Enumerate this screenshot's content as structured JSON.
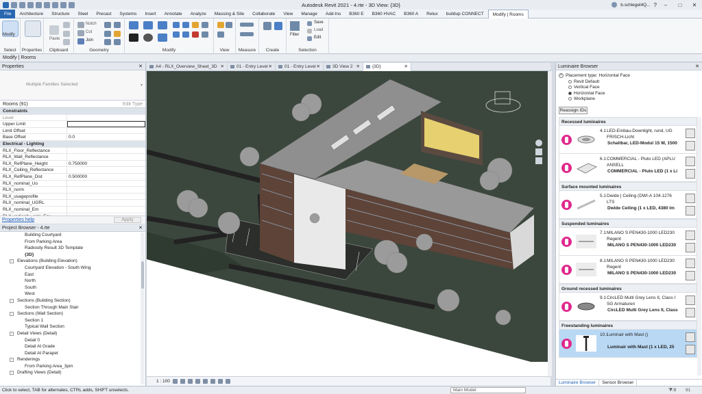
{
  "window": {
    "title": "Autodesk Revit 2021 - 4.rte - 3D View: {3D}",
    "user": "b.schlegel4Q..."
  },
  "menu": {
    "tabs": [
      "File",
      "Architecture",
      "Structure",
      "Steel",
      "Precast",
      "Systems",
      "Insert",
      "Annotate",
      "Analyze",
      "Massing & Site",
      "Collaborate",
      "View",
      "Manage",
      "Add-Ins",
      "B360 E",
      "B360 HVAC",
      "B360 A",
      "Relux",
      "buildup CONNECT",
      "Modify | Rooms"
    ],
    "active_index": 19
  },
  "ribbon": {
    "modify_label": "Modify",
    "groups": {
      "select": "Select",
      "properties": "Properties",
      "clipboard": "Clipboard",
      "geometry": "Geometry",
      "modify": "Modify",
      "view": "View",
      "measure": "Measure",
      "create": "Create",
      "selection": "Selection"
    },
    "small": {
      "notch": "Notch",
      "cut": "Cut",
      "join": "Join",
      "paste": "Paste",
      "filter": "Filter",
      "save": "Save",
      "load": "Load",
      "edit": "Edit"
    }
  },
  "context_label": "Modify | Rooms",
  "properties": {
    "header": "Properties",
    "type_selector": "Multiple Families Selected",
    "instance": "Rooms (91)",
    "edit_type": "Edit Type",
    "rows": [
      {
        "k": "Constraints",
        "v": "",
        "cat": true
      },
      {
        "k": "Level",
        "v": "",
        "dim": true
      },
      {
        "k": "Upper Limit",
        "v": "",
        "field": true
      },
      {
        "k": "Limit Offset",
        "v": ""
      },
      {
        "k": "Base Offset",
        "v": "0.0"
      },
      {
        "k": "Electrical - Lighting",
        "v": "",
        "cat": true
      },
      {
        "k": "RLX_Floor_Reflectance",
        "v": ""
      },
      {
        "k": "RLX_Wall_Reflectance",
        "v": ""
      },
      {
        "k": "RLX_RefPlane_Height",
        "v": "0.750000"
      },
      {
        "k": "RLX_Ceiling_Reflectance",
        "v": ""
      },
      {
        "k": "RLX_RefPlane_Dist",
        "v": "0.500000"
      },
      {
        "k": "RLX_nominal_Uo",
        "v": ""
      },
      {
        "k": "RLX_norm",
        "v": ""
      },
      {
        "k": "RLX_usageprofile",
        "v": ""
      },
      {
        "k": "RLX_nominal_UGRL",
        "v": ""
      },
      {
        "k": "RLX_nominal_Em",
        "v": ""
      },
      {
        "k": "RLX_radiosity_calc_Fav",
        "v": ""
      }
    ],
    "help": "Properties help",
    "apply": "Apply"
  },
  "browser": {
    "header": "Project Browser - 4.rte",
    "rows": [
      {
        "t": "Building Courtyard",
        "lvl": 2
      },
      {
        "t": "From Parking Area",
        "lvl": 2
      },
      {
        "t": "Radiosity Result 3D Template",
        "lvl": 2
      },
      {
        "t": "{3D}",
        "lvl": 2,
        "bold": true
      },
      {
        "t": "Elevations (Building Elevation)",
        "lvl": 1,
        "exp": "-"
      },
      {
        "t": "Courtyard Elevation - South Wing",
        "lvl": 2
      },
      {
        "t": "East",
        "lvl": 2
      },
      {
        "t": "North",
        "lvl": 2
      },
      {
        "t": "South",
        "lvl": 2
      },
      {
        "t": "West",
        "lvl": 2
      },
      {
        "t": "Sections (Building Section)",
        "lvl": 1,
        "exp": "-"
      },
      {
        "t": "Section Through Main Stair",
        "lvl": 2
      },
      {
        "t": "Sections (Wall Section)",
        "lvl": 1,
        "exp": "-"
      },
      {
        "t": "Section 1",
        "lvl": 2
      },
      {
        "t": "Typical Wall Section",
        "lvl": 2
      },
      {
        "t": "Detail Views (Detail)",
        "lvl": 1,
        "exp": "-"
      },
      {
        "t": "Detail 0",
        "lvl": 2
      },
      {
        "t": "Detail At Grade",
        "lvl": 2
      },
      {
        "t": "Detail At Parapet",
        "lvl": 2
      },
      {
        "t": "Renderings",
        "lvl": 1,
        "exp": "-"
      },
      {
        "t": "From Parking Area_3pm",
        "lvl": 2
      },
      {
        "t": "Drafting Views (Detail)",
        "lvl": 1,
        "exp": "-"
      }
    ]
  },
  "view_tabs": [
    {
      "label": "A4 - RLX_Overview_Sheet_3D",
      "w": 118
    },
    {
      "label": "01 - Entry Level",
      "w": 70
    },
    {
      "label": "01 - Entry Level",
      "w": 70
    },
    {
      "label": "3D View 2",
      "w": 58
    },
    {
      "label": "{3D}",
      "w": 70,
      "active": true
    }
  ],
  "view_bar": {
    "scale": "1 : 100"
  },
  "luminaire": {
    "header": "Luminaire Browser",
    "placement": "Placement type: Horizontal Face",
    "options": [
      {
        "label": "Revit Default",
        "on": false
      },
      {
        "label": "Vertical Face",
        "on": false
      },
      {
        "label": "Horizontal Face",
        "on": true
      },
      {
        "label": "Workplane",
        "on": false
      }
    ],
    "reassign": "Reassign IDs",
    "groups": [
      {
        "title": "Recessed luminaires",
        "items": [
          {
            "num": "4.1",
            "text": [
              "LED-Einbau-Downlight, rund, UG",
              "FRISCH-Licht",
              "Schaltbar, LED-Modul 15 W, 1500"
            ],
            "thumb": "downlight"
          },
          {
            "num": "6.1",
            "text": [
              "COMMERCIAL - Pluto LED (APLU",
              "ANSELL",
              "COMMERCIAL - Pluto LED (1 x Li"
            ],
            "thumb": "panel"
          }
        ]
      },
      {
        "title": "Surface mounted luminaires",
        "items": [
          {
            "num": "5.1",
            "text": [
              "Dwide | Ceiling (DWI-A 104.1276",
              "LTS",
              "Dwide Ceiling (1 x LED, 4380 lm"
            ],
            "thumb": "linear"
          }
        ]
      },
      {
        "title": "Suspended luminaires",
        "items": [
          {
            "num": "7.1",
            "text": [
              "MILANO S PEN430-1000 LED230",
              "Regent",
              "MILANO S PEN430-1000 LED230"
            ],
            "thumb": "pendant"
          },
          {
            "num": "8.1",
            "text": [
              "MILANO S PEN430-1000 LED230",
              "Regent",
              "MILANO S PEN430-1000 LED230"
            ],
            "thumb": "pendant"
          }
        ]
      },
      {
        "title": "Ground recessed luminaires",
        "items": [
          {
            "num": "9.1",
            "text": [
              "CircLED Multi Grey Lens II, Class I",
              "SG Armaturen",
              "CircLED Multi Grey Lens II, Class"
            ],
            "thumb": "disc"
          }
        ]
      },
      {
        "title": "Freestanding luminaires",
        "items": [
          {
            "num": "10.1",
            "text": [
              "Luminair with Mast ()",
              "",
              "Luminair with Mast (1 x LED, 25"
            ],
            "thumb": "mast",
            "sel": true
          }
        ]
      }
    ],
    "tabs": [
      "Luminaire Browser",
      "Sensor Browser"
    ]
  },
  "status": {
    "message": "Click to select, TAB for alternates, CTRL adds, SHIFT unselects.",
    "model": "Main Model",
    "filter": ":0",
    "filter_count": "91"
  },
  "colors": {
    "accent": "#2a67b1",
    "pin": "#e0298d",
    "roof": "#8c8c8c",
    "grass": "#3d4a3f",
    "tree": "#9a9a9a",
    "facade": "#6b4a3e"
  }
}
